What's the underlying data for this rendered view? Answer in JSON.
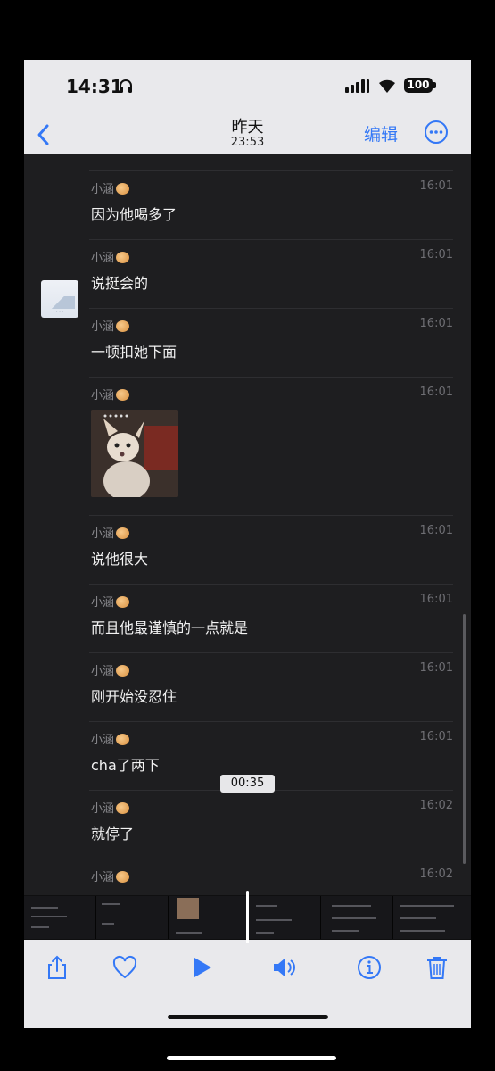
{
  "status_bar": {
    "time": "14:31",
    "battery": "100"
  },
  "nav": {
    "title": "昨天",
    "subtitle": "23:53",
    "edit_label": "编辑"
  },
  "messages": [
    {
      "sender": "小涵",
      "time": "16:01",
      "text": "因为他喝多了"
    },
    {
      "sender": "小涵",
      "time": "16:01",
      "text": "说挺会的"
    },
    {
      "sender": "小涵",
      "time": "16:01",
      "text": "一顿扣她下面"
    },
    {
      "sender": "小涵",
      "time": "16:01",
      "text": ""
    },
    {
      "sender": "小涵",
      "time": "16:01",
      "text": "说他很大"
    },
    {
      "sender": "小涵",
      "time": "16:01",
      "text": "而且他最谨慎的一点就是"
    },
    {
      "sender": "小涵",
      "time": "16:01",
      "text": "刚开始没忍住"
    },
    {
      "sender": "小涵",
      "time": "16:01",
      "text": "cha了两下"
    },
    {
      "sender": "小涵",
      "time": "16:02",
      "text": "就停了"
    },
    {
      "sender": "小涵",
      "time": "16:02",
      "text": ""
    }
  ],
  "video": {
    "current_time": "00:35"
  },
  "toolbar": {
    "icons": [
      "share-icon",
      "heart-icon",
      "play-icon",
      "volume-icon",
      "info-icon",
      "trash-icon"
    ],
    "accent": "#3478f6"
  }
}
